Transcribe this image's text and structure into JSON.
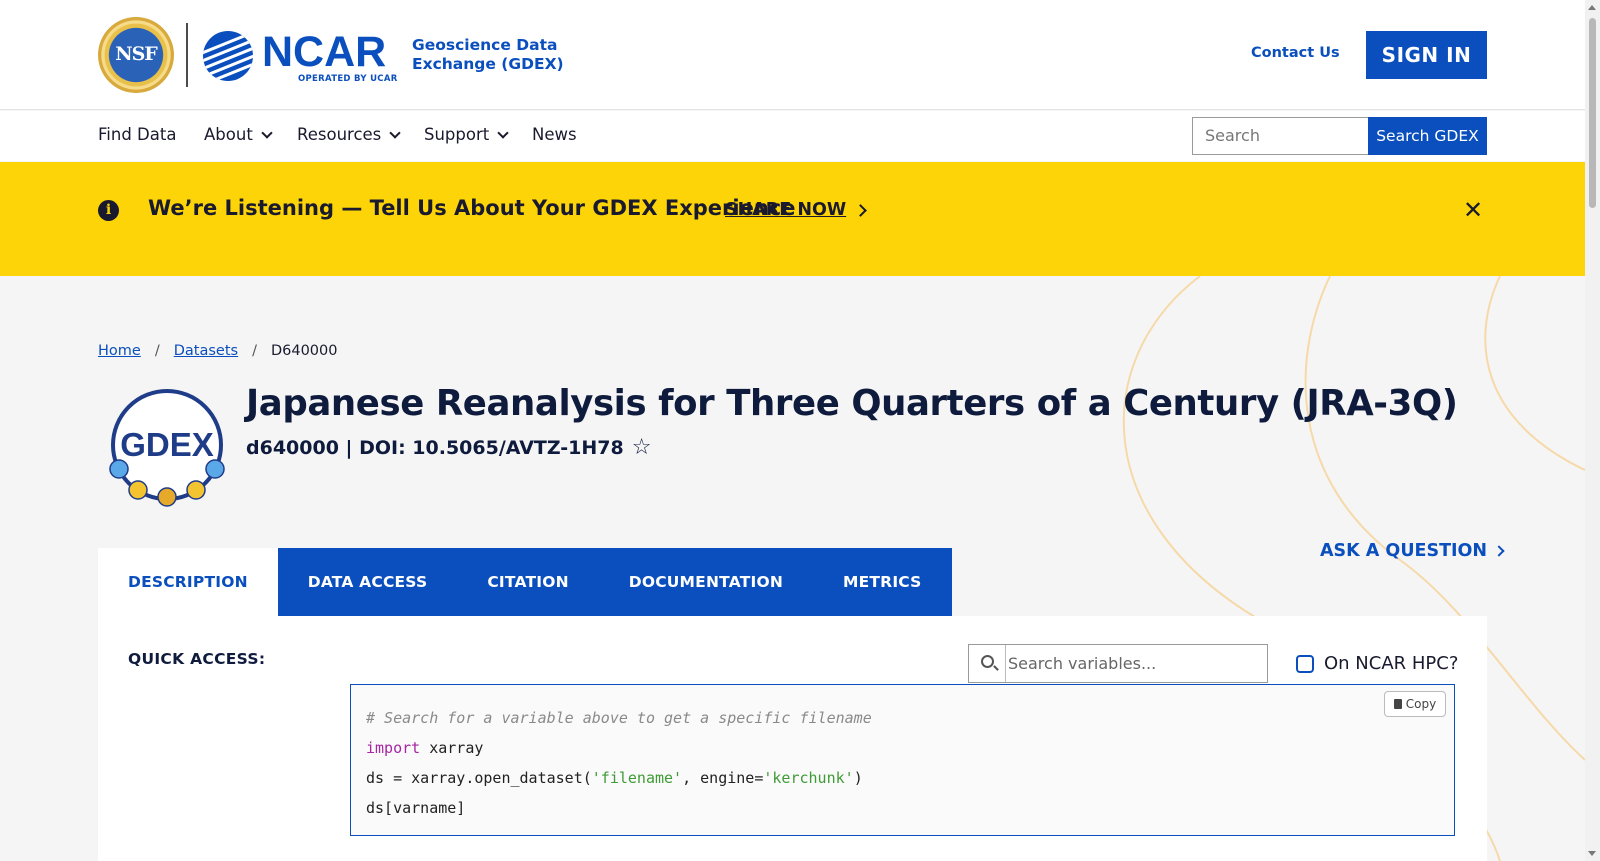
{
  "header": {
    "nsf_logo_text": "NSF",
    "ncar_logo_text": "NCAR",
    "ncar_logo_subtext": "OPERATED BY UCAR",
    "site_name": "Geoscience Data Exchange (GDEX)",
    "contact_label": "Contact Us",
    "sign_in_label": "SIGN IN"
  },
  "nav": {
    "items": [
      {
        "label": "Find Data",
        "has_dropdown": false
      },
      {
        "label": "About",
        "has_dropdown": true
      },
      {
        "label": "Resources",
        "has_dropdown": true
      },
      {
        "label": "Support",
        "has_dropdown": true
      },
      {
        "label": "News",
        "has_dropdown": false
      }
    ],
    "search_placeholder": "Search",
    "search_button_label": "Search GDEX"
  },
  "banner": {
    "icon": "info-icon",
    "text": "We’re Listening — Tell Us About Your GDEX Experience",
    "link_label": "SHARE NOW",
    "close_label": "✕",
    "background_color": "#fcd408"
  },
  "breadcrumb": {
    "home": "Home",
    "datasets": "Datasets",
    "current": "D640000"
  },
  "dataset": {
    "logo_text": "GDEX",
    "title": "Japanese Reanalysis for Three Quarters of a Century (JRA-3Q)",
    "doi_line": "d640000 | DOI: 10.5065/AVTZ-1H78",
    "favorite_icon": "star-icon"
  },
  "ask_question_label": "ASK A QUESTION",
  "tabs": [
    {
      "label": "DESCRIPTION",
      "active": true
    },
    {
      "label": "DATA ACCESS",
      "active": false
    },
    {
      "label": "CITATION",
      "active": false
    },
    {
      "label": "DOCUMENTATION",
      "active": false
    },
    {
      "label": "METRICS",
      "active": false
    }
  ],
  "quick_access": {
    "label": "QUICK ACCESS:",
    "variable_search_placeholder": "Search variables...",
    "hpc_label": "On NCAR HPC?",
    "hpc_checked": false,
    "copy_label": "Copy",
    "code": {
      "comment": "# Search for a variable above to get a specific filename",
      "import_kw": "import",
      "import_mod": " xarray",
      "line3_pre": "ds = xarray.open_dataset(",
      "line3_arg1": "'filename'",
      "line3_mid": ", engine=",
      "line3_arg2": "'kerchunk'",
      "line3_post": ")",
      "line4": "ds[varname]"
    }
  },
  "colors": {
    "brand_blue": "#0a4fbd",
    "title_navy": "#0e1b3d",
    "page_bg": "#f5f5f5"
  }
}
